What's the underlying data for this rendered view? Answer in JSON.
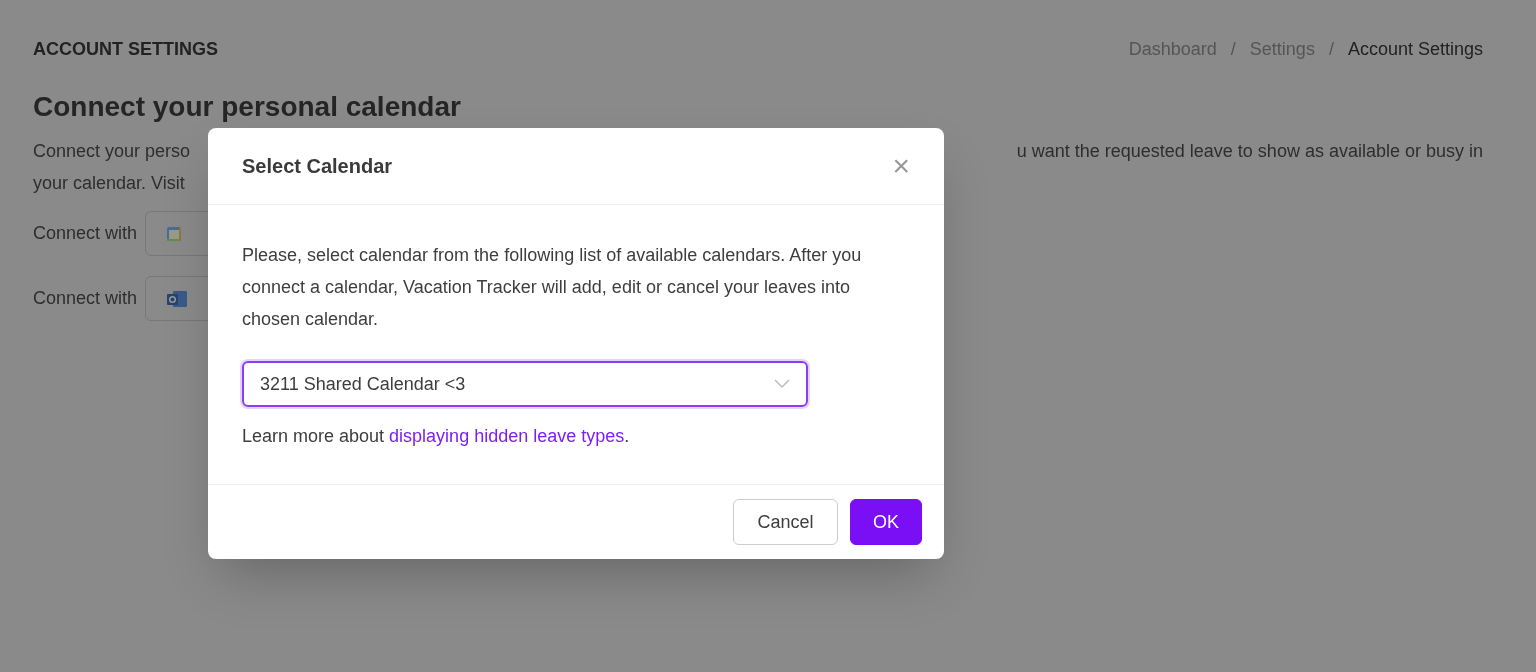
{
  "page": {
    "title": "ACCOUNT SETTINGS",
    "breadcrumbs": [
      {
        "label": "Dashboard",
        "current": false
      },
      {
        "label": "Settings",
        "current": false
      },
      {
        "label": "Account Settings",
        "current": true
      }
    ],
    "breadcrumb_separator": "/",
    "section_heading": "Connect your personal calendar",
    "description_line_1_left": "Connect your perso",
    "description_line_1_right": "u want the requested leave to show as available or busy in",
    "description_line_2": "your calendar. Visit",
    "connect_rows": [
      {
        "label": "Connect with",
        "kind": "google"
      },
      {
        "label": "Connect with",
        "kind": "outlook"
      }
    ]
  },
  "dialog": {
    "title": "Select Calendar",
    "close": "×",
    "description": "Please, select calendar from the following list of available calendars. After you connect a calendar, Vacation Tracker will add, edit or cancel your leaves into chosen calendar.",
    "calendar_select": {
      "value": "3211 Shared Calendar <3",
      "focused": true
    },
    "learn_more_prefix": "Learn more about ",
    "learn_more_link": "displaying hidden leave types",
    "learn_more_suffix": ".",
    "buttons": [
      {
        "label": "Cancel",
        "kind": "default"
      },
      {
        "label": "OK",
        "kind": "primary"
      }
    ]
  }
}
